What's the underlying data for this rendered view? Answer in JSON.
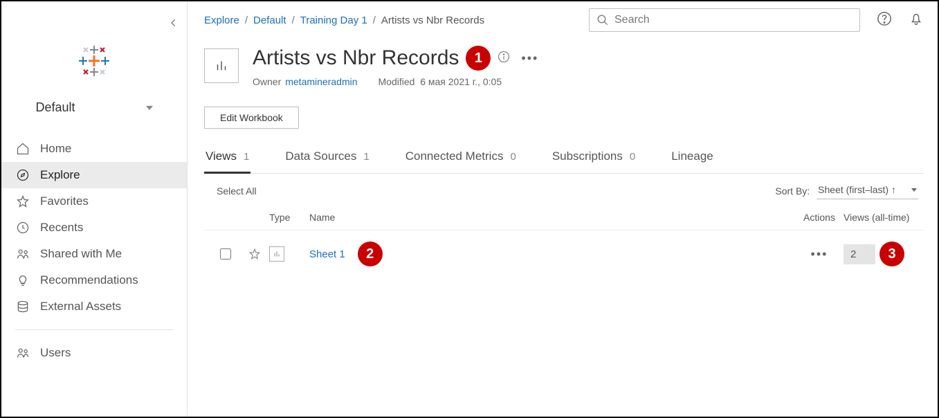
{
  "sidebar": {
    "site_label": "Default",
    "items": [
      {
        "label": "Home"
      },
      {
        "label": "Explore"
      },
      {
        "label": "Favorites"
      },
      {
        "label": "Recents"
      },
      {
        "label": "Shared with Me"
      },
      {
        "label": "Recommendations"
      },
      {
        "label": "External Assets"
      },
      {
        "label": "Users"
      }
    ]
  },
  "breadcrumb": {
    "items": [
      "Explore",
      "Default",
      "Training Day 1"
    ],
    "current": "Artists vs Nbr Records"
  },
  "search": {
    "placeholder": "Search"
  },
  "workbook": {
    "title": "Artists vs Nbr Records",
    "owner_label": "Owner",
    "owner": "metamineradmin",
    "modified_label": "Modified",
    "modified": "6 мая 2021 г., 0:05",
    "edit_btn": "Edit Workbook"
  },
  "tabs": [
    {
      "label": "Views",
      "count": "1"
    },
    {
      "label": "Data Sources",
      "count": "1"
    },
    {
      "label": "Connected Metrics",
      "count": "0"
    },
    {
      "label": "Subscriptions",
      "count": "0"
    },
    {
      "label": "Lineage",
      "count": ""
    }
  ],
  "list": {
    "select_all": "Select All",
    "sort_by_label": "Sort By:",
    "sort_value": "Sheet (first–last) ↑",
    "headers": {
      "type": "Type",
      "name": "Name",
      "actions": "Actions",
      "views": "Views (all-time)"
    },
    "rows": [
      {
        "name": "Sheet 1",
        "views": "2"
      }
    ]
  },
  "annotations": {
    "b1": "1",
    "b2": "2",
    "b3": "3"
  }
}
